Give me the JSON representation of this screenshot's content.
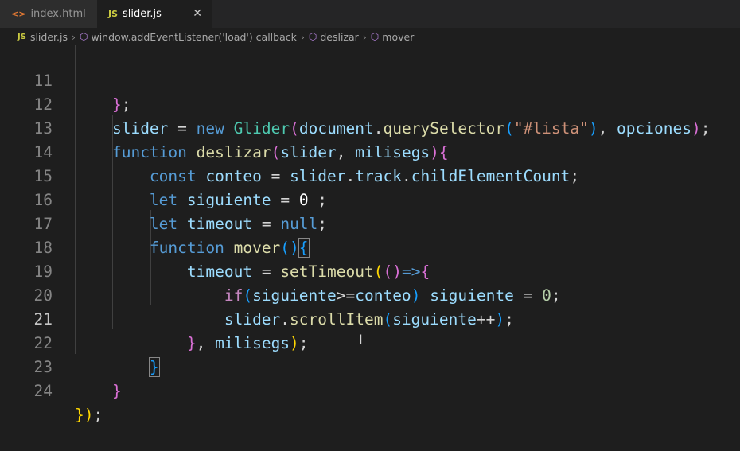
{
  "tabs": [
    {
      "name": "index.html",
      "icon": "<>",
      "active": false
    },
    {
      "name": "slider.js",
      "icon": "JS",
      "active": true,
      "close": "✕"
    }
  ],
  "breadcrumbs": [
    {
      "label": "slider.js",
      "icon": "JS"
    },
    {
      "label": "window.addEventListener('load') callback",
      "icon": "cube"
    },
    {
      "label": "deslizar",
      "icon": "cube"
    },
    {
      "label": "mover",
      "icon": "cube"
    }
  ],
  "editor": {
    "current_line": 21,
    "lines": [
      {
        "n": "11"
      },
      {
        "n": "12"
      },
      {
        "n": "13"
      },
      {
        "n": "14"
      },
      {
        "n": "15"
      },
      {
        "n": "16"
      },
      {
        "n": "17"
      },
      {
        "n": "18"
      },
      {
        "n": "19"
      },
      {
        "n": "20"
      },
      {
        "n": "21"
      },
      {
        "n": "22"
      },
      {
        "n": "23"
      },
      {
        "n": "24"
      }
    ],
    "t": {
      "l11": "};",
      "slider": "slider",
      "eq": " = ",
      "new": "new",
      "glider": "Glider",
      "document": "document",
      "qs": "querySelector",
      "lista": "\"#lista\"",
      "opciones": "opciones",
      "function": "function",
      "deslizar": "deslizar",
      "milisegs": "milisegs",
      "const": "const",
      "conteo": "conteo",
      "track": "track",
      "childcount": "childElementCount",
      "let": "let",
      "siguiente": "siguiente",
      "zero": "0",
      "timeout": "timeout",
      "null": "null",
      "mover": "mover",
      "settimeout": "setTimeout",
      "arrow": "=>",
      "if": "if",
      "gte": ">=",
      "scrollitem": "scrollItem",
      "inc": "++"
    }
  }
}
